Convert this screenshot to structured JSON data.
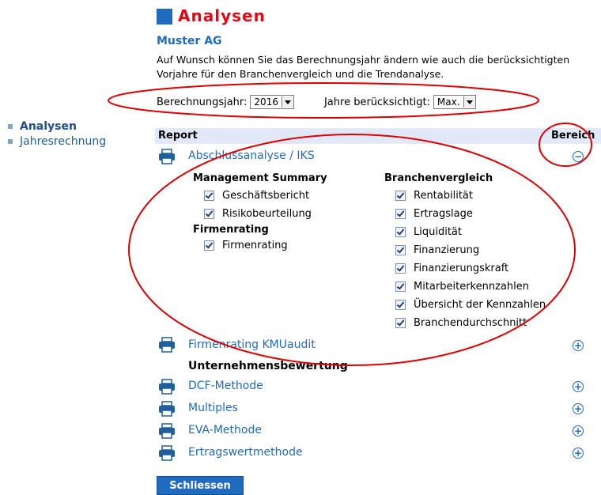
{
  "nav": [
    {
      "label": "Analysen",
      "active": true
    },
    {
      "label": "Jahresrechnung",
      "active": false
    }
  ],
  "title": "Analysen",
  "company": "Muster AG",
  "description": "Auf Wunsch können Sie das Berechnungsjahr ändern wie auch die berücksichtigten Vorjahre für den Branchenvergleich und die Trendanalyse.",
  "year_selector": {
    "label": "Berechnungsjahr:",
    "value": "2016"
  },
  "years_considered": {
    "label": "Jahre berücksichtigt:",
    "value": "Max."
  },
  "report_header": {
    "left": "Report",
    "right": "Bereich"
  },
  "reports": {
    "abschluss": {
      "label": "Abschlussanalyse / IKS",
      "expanded": true
    },
    "firmenrating_kmu": {
      "label": "Firmenrating KMUaudit"
    },
    "unternehmensbewertung_heading": "Unternehmensbewertung",
    "dcf": {
      "label": "DCF-Methode"
    },
    "multiples": {
      "label": "Multiples"
    },
    "eva": {
      "label": "EVA-Methode"
    },
    "ertragswert": {
      "label": "Ertragswertmethode"
    }
  },
  "abschluss_sections": {
    "management_summary": {
      "heading": "Management Summary",
      "items": [
        "Geschäftsbericht",
        "Risikobeurteilung"
      ]
    },
    "firmenrating": {
      "heading": "Firmenrating",
      "items": [
        "Firmenrating"
      ]
    },
    "branchenvergleich": {
      "heading": "Branchenvergleich",
      "items": [
        "Rentabilität",
        "Ertragslage",
        "Liquidität",
        "Finanzierung",
        "Finanzierungskraft",
        "Mitarbeiterkennzahlen",
        "Übersicht der Kennzahlen",
        "Branchendurchschnitt"
      ]
    }
  },
  "close_button": "Schliessen",
  "colors": {
    "accent": "#1f6bbf",
    "title_red": "#e30613",
    "annotation_red": "#dd0000"
  }
}
